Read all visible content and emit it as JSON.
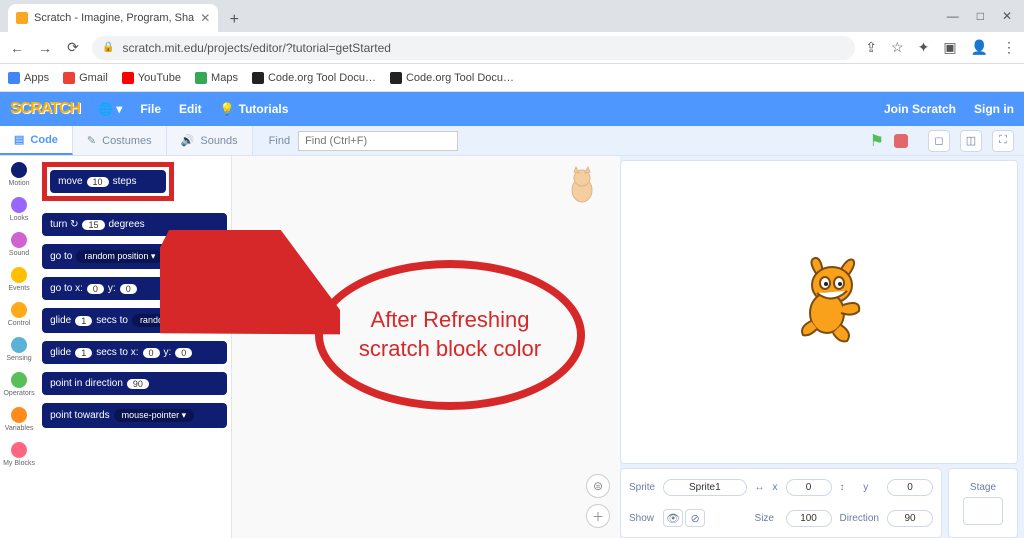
{
  "browser": {
    "tab_title": "Scratch - Imagine, Program, Sha",
    "url": "scratch.mit.edu/projects/editor/?tutorial=getStarted",
    "new_tab": "+",
    "win": {
      "min": "—",
      "max": "□",
      "close": "✕"
    },
    "nav": {
      "back": "←",
      "fwd": "→",
      "reload": "⟳"
    },
    "ext": {
      "share": "⇪",
      "star": "☆",
      "puzzle": "✦",
      "sq": "▣",
      "user": "👤",
      "menu": "⋮"
    }
  },
  "bookmarks": [
    {
      "label": "Apps",
      "color": "#4285f4"
    },
    {
      "label": "Gmail",
      "color": "#ea4335"
    },
    {
      "label": "YouTube",
      "color": "#ff0000"
    },
    {
      "label": "Maps",
      "color": "#34a853"
    },
    {
      "label": "Code.org Tool Docu…",
      "color": "#222"
    },
    {
      "label": "Code.org Tool Docu…",
      "color": "#222"
    }
  ],
  "menubar": {
    "logo": "SCRATCH",
    "globe": "🌐 ▾",
    "file": "File",
    "edit": "Edit",
    "tutorials": "Tutorials",
    "join": "Join Scratch",
    "signin": "Sign in"
  },
  "editor_tabs": {
    "code": "Code",
    "costumes": "Costumes",
    "sounds": "Sounds",
    "find_label": "Find",
    "find_placeholder": "Find (Ctrl+F)"
  },
  "categories": [
    {
      "name": "Motion",
      "color": "#0f1e70"
    },
    {
      "name": "Looks",
      "color": "#9966ff"
    },
    {
      "name": "Sound",
      "color": "#cf63cf"
    },
    {
      "name": "Events",
      "color": "#ffbf00"
    },
    {
      "name": "Control",
      "color": "#ffab19"
    },
    {
      "name": "Sensing",
      "color": "#5cb1d6"
    },
    {
      "name": "Operators",
      "color": "#59c059"
    },
    {
      "name": "Variables",
      "color": "#ff8c1a"
    },
    {
      "name": "My Blocks",
      "color": "#ff6680"
    }
  ],
  "blocks": {
    "move": {
      "pre": "move",
      "val": "10",
      "post": "steps"
    },
    "turn": {
      "pre": "turn ↻",
      "val": "15",
      "post": "degrees"
    },
    "goto": {
      "pre": "go to",
      "dd": "random position ▾"
    },
    "gotoxy": {
      "pre": "go to x:",
      "v1": "0",
      "mid": "y:",
      "v2": "0"
    },
    "glide": {
      "pre": "glide",
      "v1": "1",
      "mid": "secs to",
      "dd": "random position ▾"
    },
    "glidexy": {
      "pre": "glide",
      "v1": "1",
      "m1": "secs to x:",
      "v2": "0",
      "m2": "y:",
      "v3": "0"
    },
    "point": {
      "pre": "point in direction",
      "val": "90"
    },
    "pointto": {
      "pre": "point towards",
      "dd": "mouse-pointer ▾"
    }
  },
  "stage_controls": {
    "fullscreen": "⛶"
  },
  "sprite": {
    "label": "Sprite",
    "name": "Sprite1",
    "x_lbl": "x",
    "x": "0",
    "y_lbl": "y",
    "y": "0",
    "show_lbl": "Show",
    "size_lbl": "Size",
    "size": "100",
    "dir_lbl": "Direction",
    "dir": "90"
  },
  "stage_label": "Stage",
  "annotation": "After Refreshing scratch block color"
}
